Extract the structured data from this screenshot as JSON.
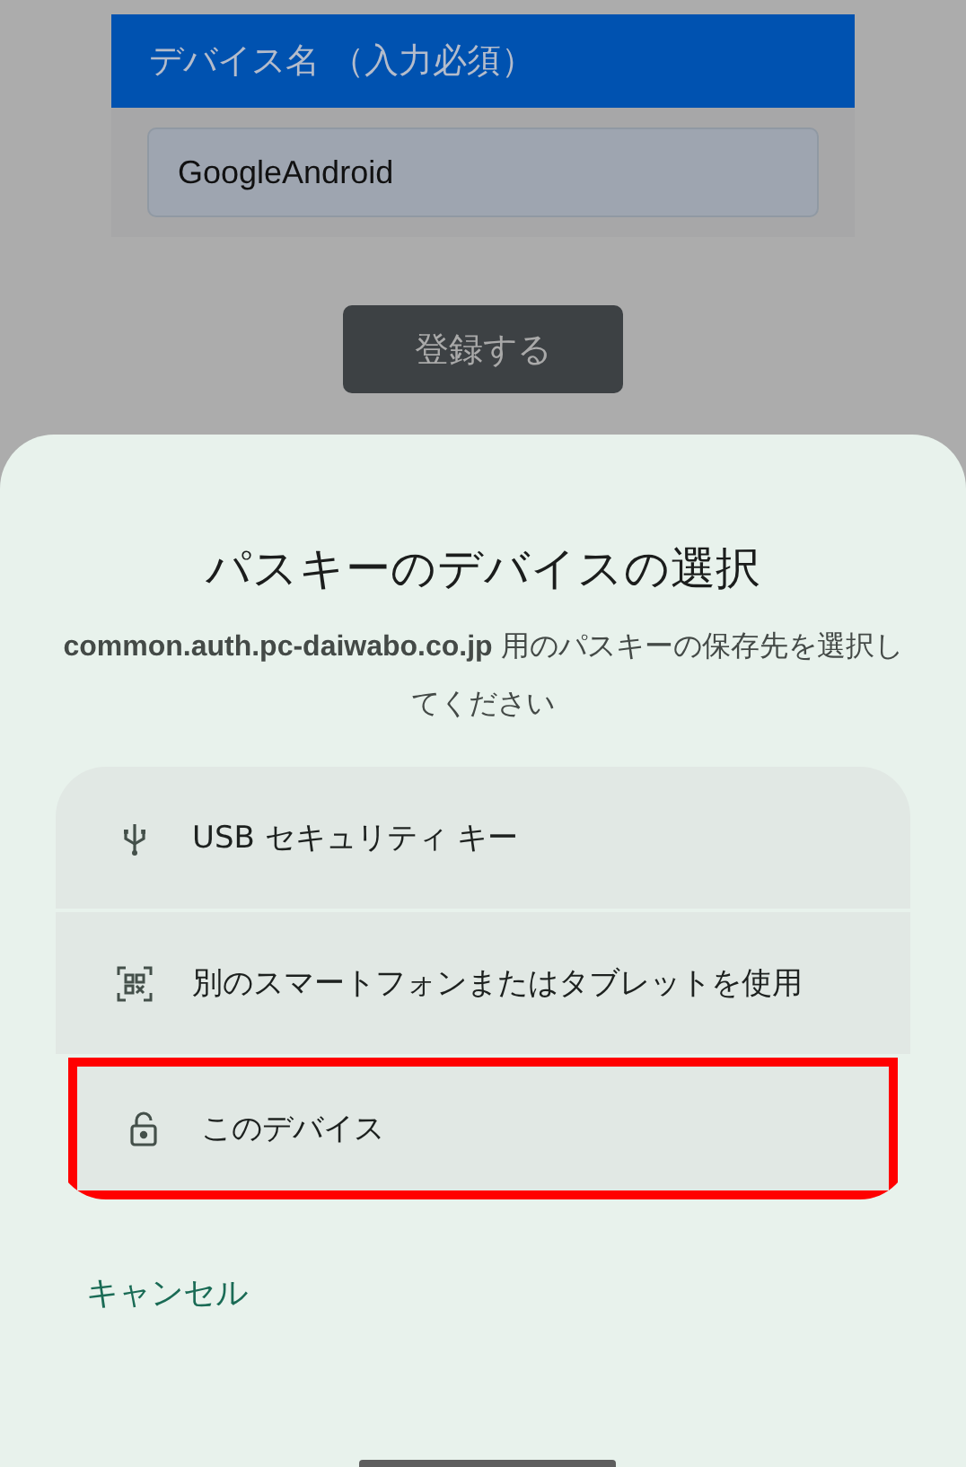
{
  "form": {
    "label": "デバイス名 （入力必須）",
    "device_name": "GoogleAndroid",
    "submit": "登録する"
  },
  "sheet": {
    "title": "パスキーのデバイスの選択",
    "description": "**common.auth.pc-daiwabo.co.jp** 用のパスキーの保存先を選択してください",
    "options": [
      {
        "kind": "usb",
        "label": "USB セキュリティ キー",
        "highlighted": false
      },
      {
        "kind": "qr",
        "label": "別のスマートフォンまたはタブレットを使用",
        "highlighted": false
      },
      {
        "kind": "lock",
        "label": "このデバイス",
        "highlighted": true
      }
    ],
    "cancel": "キャンセル"
  }
}
